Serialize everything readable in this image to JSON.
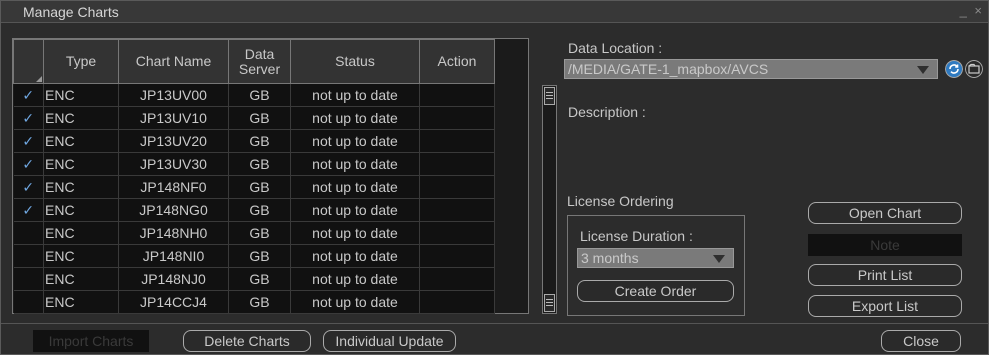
{
  "window": {
    "title": "Manage Charts",
    "controls": "_ ×"
  },
  "table": {
    "columns": [
      "Type",
      "Chart Name",
      "Data\nServer",
      "Status",
      "Action"
    ],
    "rows": [
      {
        "checked": true,
        "type": "ENC",
        "name": "JP13UV00",
        "server": "GB",
        "status": "not up to date",
        "action": ""
      },
      {
        "checked": true,
        "type": "ENC",
        "name": "JP13UV10",
        "server": "GB",
        "status": "not up to date",
        "action": ""
      },
      {
        "checked": true,
        "type": "ENC",
        "name": "JP13UV20",
        "server": "GB",
        "status": "not up to date",
        "action": ""
      },
      {
        "checked": true,
        "type": "ENC",
        "name": "JP13UV30",
        "server": "GB",
        "status": "not up to date",
        "action": ""
      },
      {
        "checked": true,
        "type": "ENC",
        "name": "JP148NF0",
        "server": "GB",
        "status": "not up to date",
        "action": ""
      },
      {
        "checked": true,
        "type": "ENC",
        "name": "JP148NG0",
        "server": "GB",
        "status": "not up to date",
        "action": ""
      },
      {
        "checked": false,
        "type": "ENC",
        "name": "JP148NH0",
        "server": "GB",
        "status": "not up to date",
        "action": ""
      },
      {
        "checked": false,
        "type": "ENC",
        "name": "JP148NI0",
        "server": "GB",
        "status": "not up to date",
        "action": ""
      },
      {
        "checked": false,
        "type": "ENC",
        "name": "JP148NJ0",
        "server": "GB",
        "status": "not up to date",
        "action": ""
      },
      {
        "checked": false,
        "type": "ENC",
        "name": "JP14CCJ4",
        "server": "GB",
        "status": "not up to date",
        "action": ""
      }
    ],
    "check_glyph": "✓"
  },
  "right": {
    "data_location_label": "Data Location :",
    "data_location_value": "/MEDIA/GATE-1_mapbox/AVCS",
    "description_label": "Description :",
    "license_ordering_label": "License Ordering",
    "license_duration_label": "License Duration :",
    "license_duration_value": "3 months",
    "create_order": "Create Order",
    "open_chart": "Open Chart",
    "note": "Note",
    "print_list": "Print List",
    "export_list": "Export List"
  },
  "bottom": {
    "import_charts": "Import Charts",
    "delete_charts": "Delete Charts",
    "individual_update": "Individual Update",
    "close": "Close"
  },
  "icons": {
    "refresh": "refresh-icon",
    "folder": "folder-icon"
  },
  "colors": {
    "refresh_icon": "#2f7ac0",
    "check": "#6fa6e0"
  }
}
